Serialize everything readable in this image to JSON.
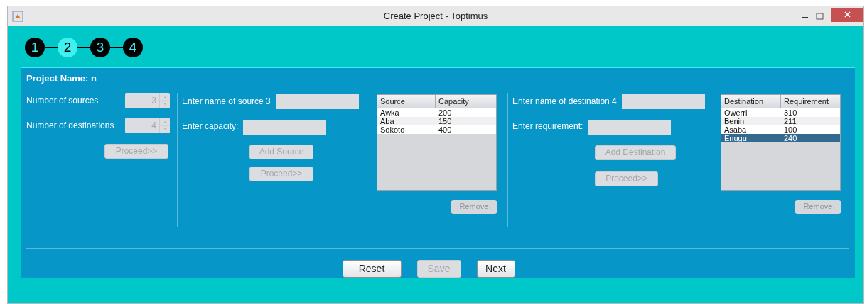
{
  "window": {
    "title": "Create Project - Toptimus"
  },
  "steps": [
    {
      "label": "1",
      "selected": false
    },
    {
      "label": "2",
      "selected": true
    },
    {
      "label": "3",
      "selected": false
    },
    {
      "label": "4",
      "selected": false
    }
  ],
  "project_name": "Project Name: n",
  "counts": [
    {
      "label": "Number of sources",
      "value": "3",
      "disabled": true
    },
    {
      "label": "Number of destinations",
      "value": "4",
      "disabled": true
    }
  ],
  "counts_proceed": {
    "label": "Proceed>>",
    "disabled": true
  },
  "sources": {
    "name_label": "Enter name of source 3",
    "amount_label": "Enter capacity:",
    "add_button": {
      "label": "Add Source",
      "disabled": true
    },
    "proceed_button": {
      "label": "Proceed>>",
      "disabled": true
    },
    "table": {
      "columns": [
        "Source",
        "Capacity"
      ],
      "rows": [
        {
          "cells": [
            "Awka",
            "200"
          ],
          "selected": false
        },
        {
          "cells": [
            "Aba",
            "150"
          ],
          "selected": false
        },
        {
          "cells": [
            "Sokoto",
            "400"
          ],
          "selected": false
        }
      ]
    },
    "remove_button": {
      "label": "Remove",
      "disabled": true
    }
  },
  "destinations": {
    "name_label": "Enter name of destination 4",
    "amount_label": "Enter requirement:",
    "add_button": {
      "label": "Add Destination",
      "disabled": true
    },
    "proceed_button": {
      "label": "Proceed>>",
      "disabled": true
    },
    "table": {
      "columns": [
        "Destination",
        "Requirement"
      ],
      "rows": [
        {
          "cells": [
            "Owerri",
            "310"
          ],
          "selected": false
        },
        {
          "cells": [
            "Benin",
            "211"
          ],
          "selected": false
        },
        {
          "cells": [
            "Asaba",
            "100"
          ],
          "selected": false
        },
        {
          "cells": [
            "Enugu",
            "240"
          ],
          "selected": true
        }
      ]
    },
    "remove_button": {
      "label": "Remove",
      "disabled": true
    }
  },
  "footer_buttons": [
    {
      "label": "Reset",
      "disabled": false
    },
    {
      "label": "Save",
      "disabled": true
    },
    {
      "label": "Next",
      "disabled": false
    }
  ]
}
